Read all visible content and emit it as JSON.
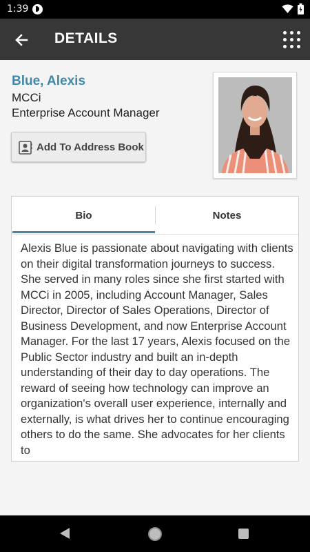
{
  "status_bar": {
    "time": "1:39"
  },
  "app_bar": {
    "title": "DETAILS"
  },
  "contact": {
    "name": "Blue, Alexis",
    "company": "MCCi",
    "job_title": "Enterprise Account Manager",
    "add_button_label": "Add To Address Book"
  },
  "tabs": [
    {
      "label": "Bio",
      "selected": true
    },
    {
      "label": "Notes",
      "selected": false
    }
  ],
  "bio": {
    "text": "Alexis Blue is passionate about navigating with clients on their digital transformation journeys to success. She served in many roles since she first started with MCCi in 2005, including Account Manager, Sales Director, Director of Sales Operations, Director of Business Development, and now Enterprise Account Manager. For the last 17 years, Alexis focused on the Public Sector industry and built an in-depth understanding of their day to day operations. The reward of seeing how technology can improve an organization's overall user experience, internally and externally, is what drives her to continue encouraging others to do the same. She advocates for her clients to"
  },
  "colors": {
    "app_bar": "#373737",
    "name_accent": "#3f88a8",
    "tab_indicator": "#4a86a8"
  },
  "icons": {
    "back": "arrow-left-icon",
    "menu": "grid-menu-icon",
    "address_book": "contact-card-icon"
  }
}
